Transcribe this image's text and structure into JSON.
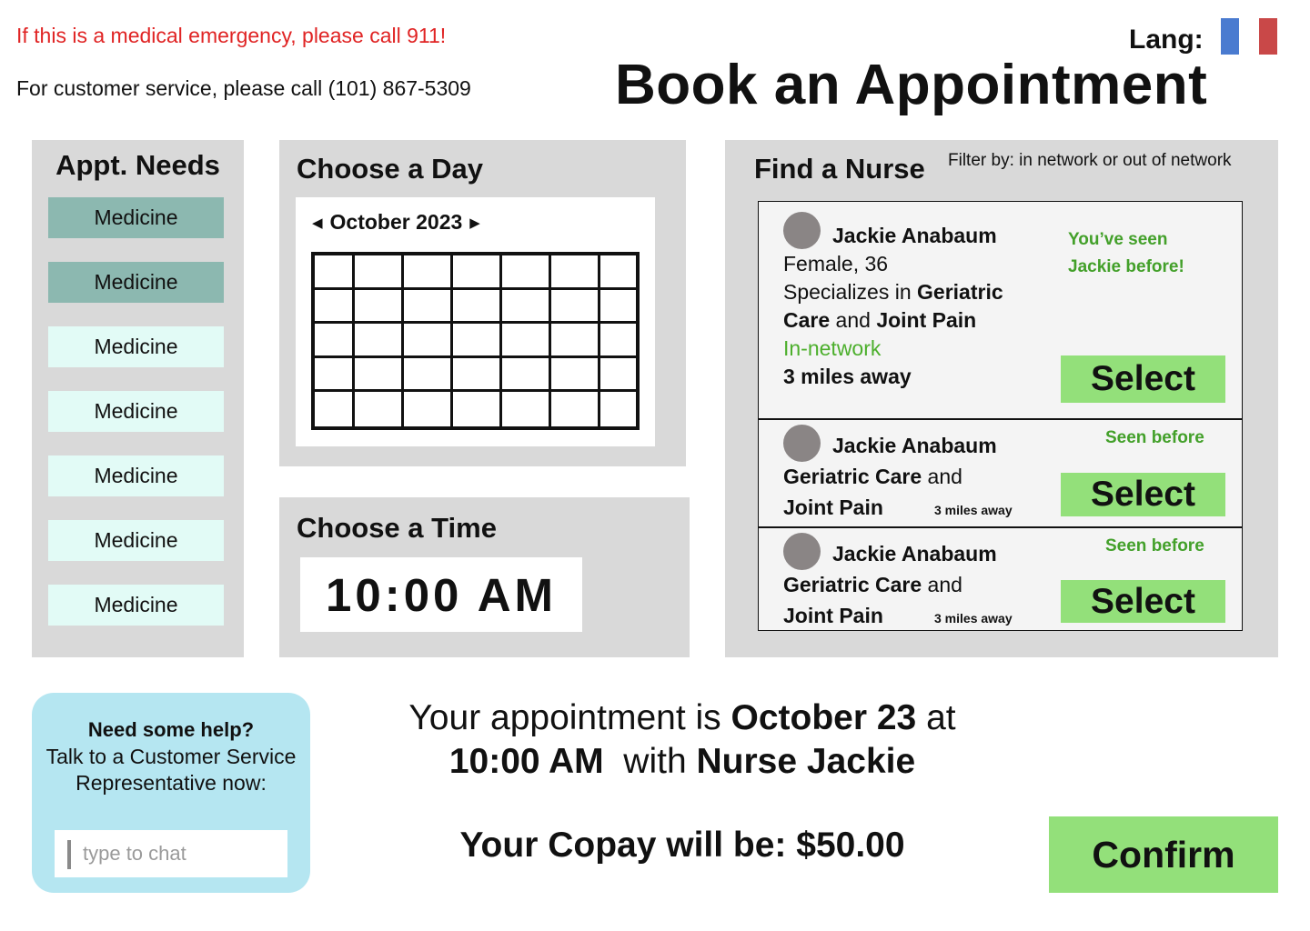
{
  "header": {
    "emergency_text": "If this is a medical emergency, please call 911!",
    "service_text": "For customer service, please call (101) 867-5309",
    "lang_label": "Lang:",
    "flag_colors": [
      "#4a7bd0",
      "#c94848"
    ],
    "title": "Book an Appointment"
  },
  "needs": {
    "title": "Appt. Needs",
    "selected_color": "#8cb8b0",
    "unselected_color": "#e2fbf6",
    "items": [
      {
        "label": "Medicine",
        "selected": true
      },
      {
        "label": "Medicine",
        "selected": true
      },
      {
        "label": "Medicine",
        "selected": false
      },
      {
        "label": "Medicine",
        "selected": false
      },
      {
        "label": "Medicine",
        "selected": false
      },
      {
        "label": "Medicine",
        "selected": false
      },
      {
        "label": "Medicine",
        "selected": false
      }
    ]
  },
  "day": {
    "title": "Choose a Day",
    "month": "October 2023",
    "prev_icon": "triangle-left-icon",
    "next_icon": "triangle-right-icon"
  },
  "time": {
    "title": "Choose a Time",
    "value": "10:00 AM"
  },
  "nurse": {
    "title": "Find a Nurse",
    "filter_text": "Filter by: in network or out of network",
    "cards": [
      {
        "name": "Jackie Anabaum",
        "gender_age": "Female, 36",
        "spec_prefix": "Specializes in ",
        "spec_bold1": "Geriatric",
        "spec_bold2": "Care",
        "spec_and": " and ",
        "spec_bold3": "Joint Pain",
        "network": "In-network",
        "distance": "3 miles away",
        "seen_line1": "You’ve seen",
        "seen_line2": "Jackie before!",
        "select_label": "Select"
      },
      {
        "name": "Jackie Anabaum",
        "spec_bold1": "Geriatric Care",
        "spec_and": " and",
        "spec_bold2": "Joint Pain",
        "distance": "3 miles away",
        "seen": "Seen before",
        "select_label": "Select"
      },
      {
        "name": "Jackie Anabaum",
        "spec_bold1": "Geriatric Care",
        "spec_and": " and",
        "spec_bold2": "Joint Pain",
        "distance": "3 miles away",
        "seen": "Seen before",
        "select_label": "Select"
      }
    ]
  },
  "help": {
    "title": "Need some help?",
    "body": "Talk to a Customer Service Representative now:",
    "chat_placeholder": "type to chat"
  },
  "summary": {
    "prefix": "Your appointment is ",
    "date": "October 23",
    "at": " at",
    "time": "10:00 AM",
    "with": "  with ",
    "nurse": "Nurse Jackie",
    "copay": "Your Copay will be: $50.00",
    "confirm_label": "Confirm"
  }
}
